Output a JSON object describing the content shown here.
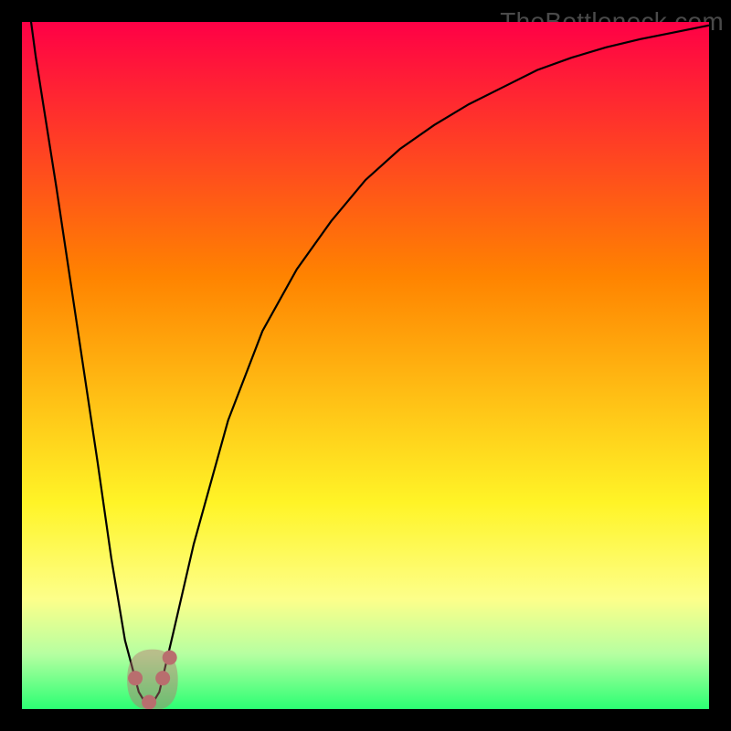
{
  "watermark": {
    "text": "TheBottleneck.com"
  },
  "colors": {
    "black": "#000000",
    "gradient_top": "#ff0046",
    "gradient_q1": "#ff8300",
    "gradient_mid": "#fff427",
    "gradient_lightyellow": "#fdff8a",
    "gradient_mint": "#b6ffa1",
    "gradient_green": "#2bff73",
    "curve_stroke": "#000000",
    "markers": "#b96e6e"
  },
  "chart_data": {
    "type": "line",
    "title": "",
    "xlabel": "",
    "ylabel": "",
    "xlim": [
      0,
      100
    ],
    "ylim": [
      0,
      100
    ],
    "x": [
      0,
      2,
      5,
      8,
      11,
      13,
      15,
      17,
      18.5,
      20,
      22,
      25,
      30,
      35,
      40,
      45,
      50,
      55,
      60,
      65,
      70,
      75,
      80,
      85,
      90,
      95,
      100
    ],
    "y": [
      110,
      95,
      76,
      56,
      36,
      22,
      10,
      2.5,
      0,
      2.5,
      11,
      24,
      42,
      55,
      64,
      71,
      77,
      81.5,
      85,
      88,
      90.5,
      93,
      94.8,
      96.3,
      97.5,
      98.5,
      99.5
    ],
    "trough_markers": [
      {
        "x": 16.5,
        "y": 4.5
      },
      {
        "x": 18.5,
        "y": 1.0
      },
      {
        "x": 20.5,
        "y": 4.5
      },
      {
        "x": 21.5,
        "y": 7.5
      }
    ]
  }
}
